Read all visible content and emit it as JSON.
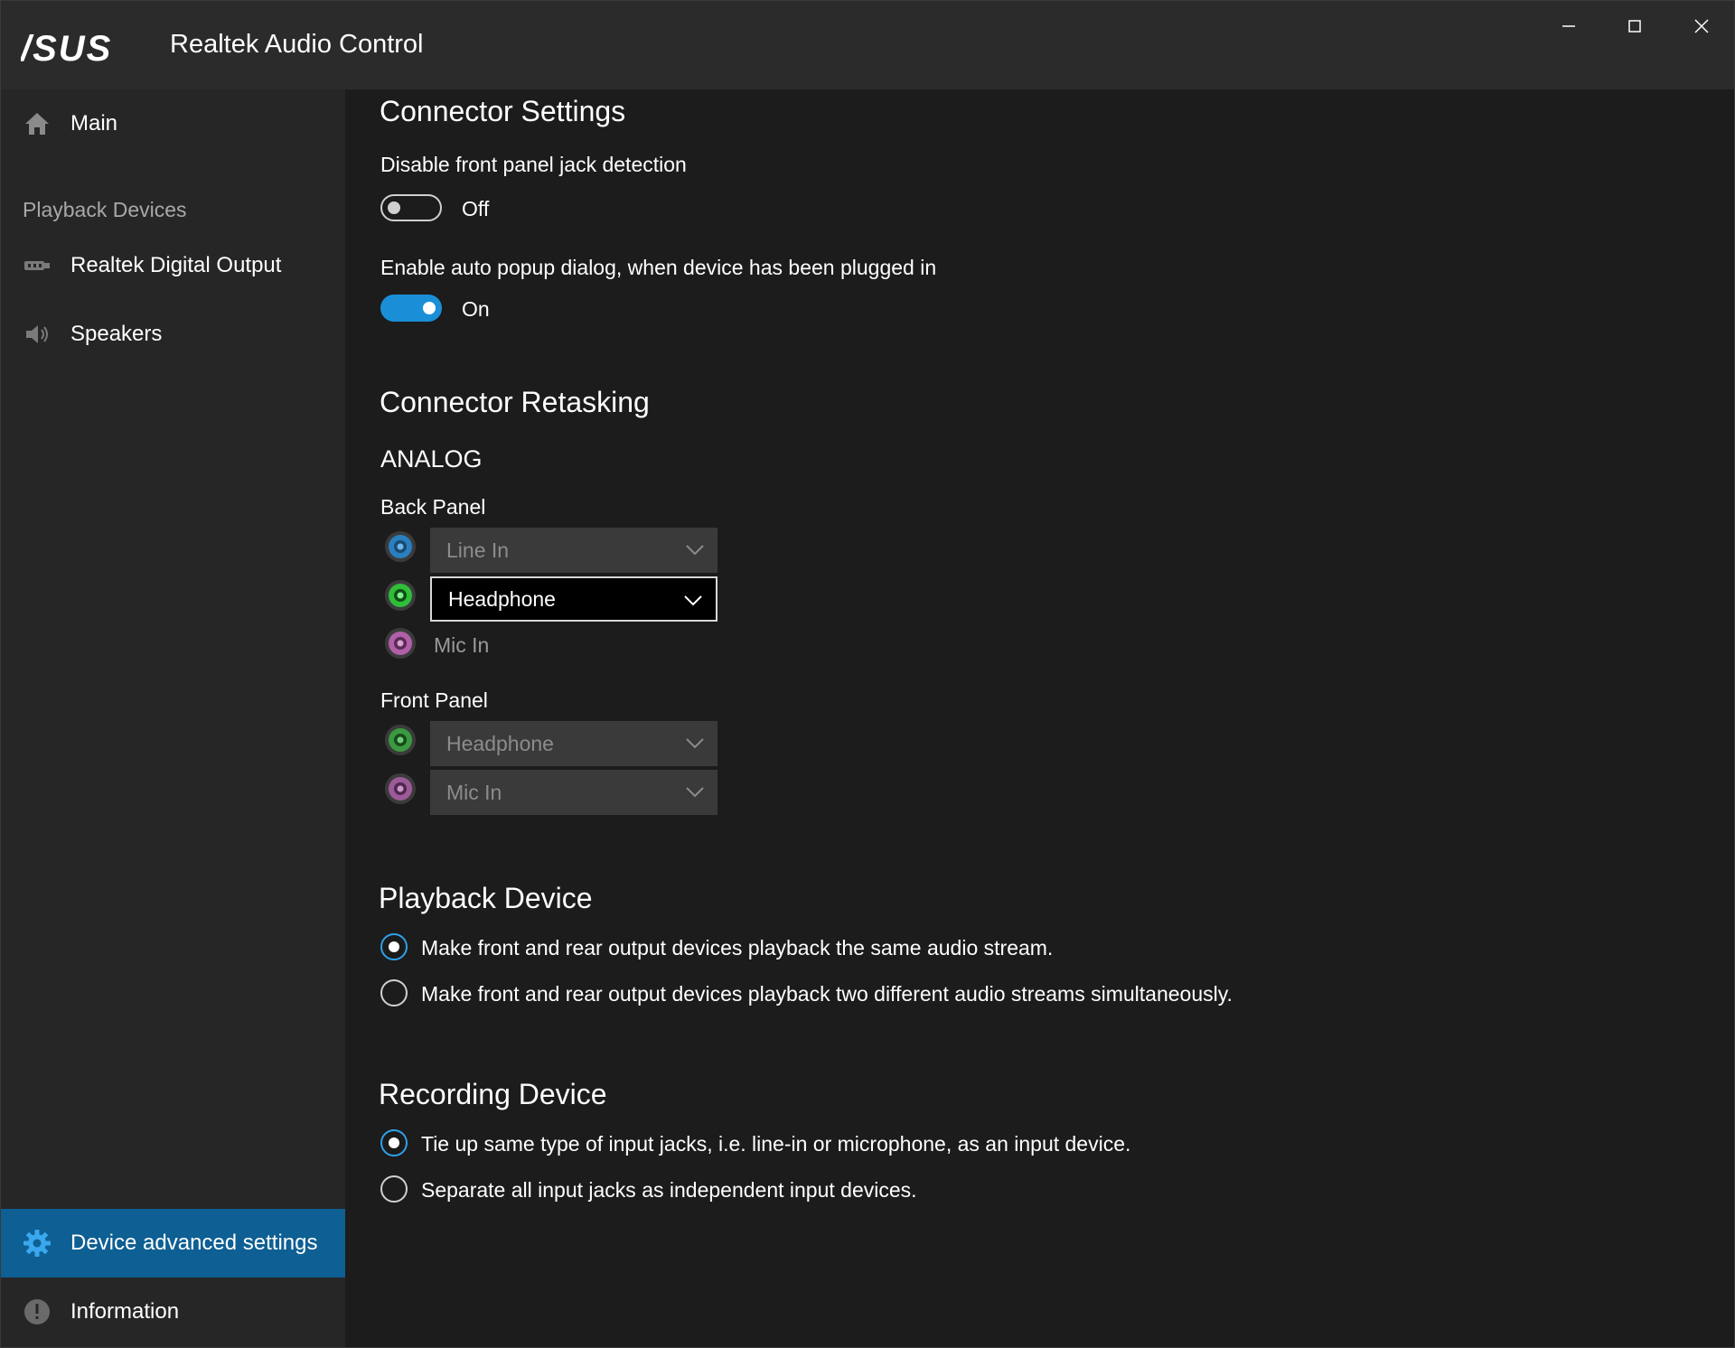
{
  "titlebar": {
    "brand": "ASUS",
    "title": "Realtek Audio Control",
    "minimize_icon": "minimize-icon",
    "maximize_icon": "maximize-icon",
    "close_icon": "close-icon"
  },
  "sidebar": {
    "main": {
      "label": "Main",
      "icon": "home-icon"
    },
    "section_label": "Playback Devices",
    "devices": [
      {
        "label": "Realtek Digital Output",
        "icon": "digital-output-icon"
      },
      {
        "label": "Speakers",
        "icon": "speaker-icon"
      }
    ],
    "advanced": {
      "label": "Device advanced settings",
      "icon": "gear-icon"
    },
    "information": {
      "label": "Information",
      "icon": "info-icon"
    }
  },
  "connector_settings": {
    "title": "Connector Settings",
    "jack_detection": {
      "label": "Disable front panel jack detection",
      "state": "Off"
    },
    "auto_popup": {
      "label": "Enable auto popup dialog, when device has been plugged in",
      "state": "On"
    }
  },
  "connector_retasking": {
    "title": "Connector Retasking",
    "group": "ANALOG",
    "back_panel": {
      "label": "Back Panel",
      "jacks": [
        {
          "color": "#2a7fc0",
          "value": "Line In",
          "type": "dropdown-disabled"
        },
        {
          "color": "#2fbd3a",
          "value": "Headphone",
          "type": "dropdown"
        },
        {
          "color": "#b05fa8",
          "value": "Mic In",
          "type": "label"
        }
      ]
    },
    "front_panel": {
      "label": "Front Panel",
      "jacks": [
        {
          "color": "#3a9a40",
          "value": "Headphone",
          "type": "dropdown-disabled"
        },
        {
          "color": "#9c5a98",
          "value": "Mic In",
          "type": "dropdown-disabled"
        }
      ]
    }
  },
  "playback_device": {
    "title": "Playback Device",
    "options": [
      {
        "label": "Make front and rear output devices playback the same audio stream.",
        "selected": true
      },
      {
        "label": "Make front and rear output devices playback two different audio streams simultaneously.",
        "selected": false
      }
    ]
  },
  "recording_device": {
    "title": "Recording Device",
    "options": [
      {
        "label": "Tie up same type of input jacks, i.e. line-in or microphone, as an input device.",
        "selected": true
      },
      {
        "label": "Separate all input jacks as independent input devices.",
        "selected": false
      }
    ]
  },
  "colors": {
    "accent": "#1a8fd8",
    "active_nav": "#0e5f93"
  }
}
